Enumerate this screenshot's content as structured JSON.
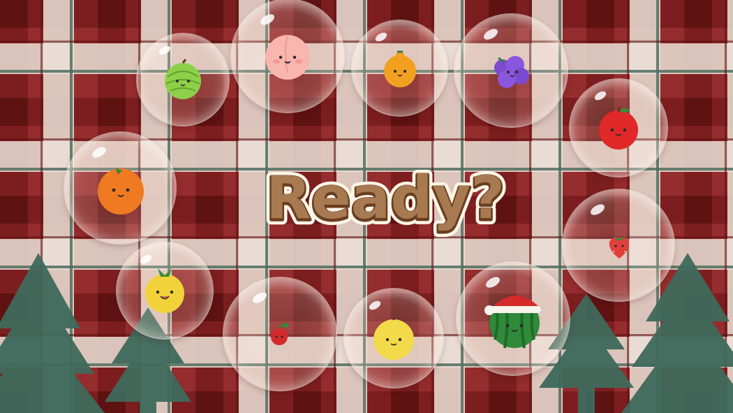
{
  "title": {
    "text": "Ready?"
  },
  "colors": {
    "plaid_red": "#9b2f30",
    "plaid_dark": "#6e1616",
    "plaid_cream": "#f4ece0",
    "plaid_green": "#4e7a6a",
    "tree": "#3f6a5c",
    "title_fill": "#a87a52",
    "title_outline": "#fff6e8"
  },
  "fruits": [
    {
      "id": "cherry",
      "icon": "cherry-icon",
      "color": "#d52a2a"
    },
    {
      "id": "strawberry",
      "icon": "strawberry-icon",
      "color": "#e0403c"
    },
    {
      "id": "grape",
      "icon": "grape-icon",
      "color": "#7b4ad0"
    },
    {
      "id": "dekopon",
      "icon": "dekopon-icon",
      "color": "#f2a020"
    },
    {
      "id": "orange",
      "icon": "orange-icon",
      "color": "#f07a22"
    },
    {
      "id": "apple",
      "icon": "apple-icon",
      "color": "#e02828"
    },
    {
      "id": "pear",
      "icon": "pear-icon",
      "color": "#f3da4a"
    },
    {
      "id": "peach",
      "icon": "peach-icon",
      "color": "#f8b6ae"
    },
    {
      "id": "pineapple",
      "icon": "pineapple-icon",
      "color": "#f2d23a"
    },
    {
      "id": "melon",
      "icon": "melon-icon",
      "color": "#8ed04a"
    },
    {
      "id": "watermelon",
      "icon": "watermelon-santa-hat-icon",
      "color": "#2f8a3a"
    }
  ]
}
